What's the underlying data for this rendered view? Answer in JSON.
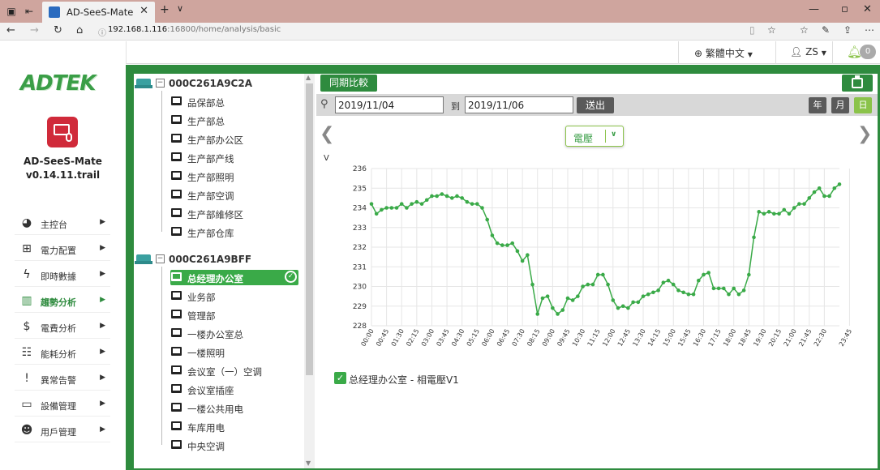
{
  "browser": {
    "tab_title": "AD-SeeS-Mate",
    "url_host": "192.168.1.116",
    "url_path": ":16800/home/analysis/basic"
  },
  "header": {
    "language": "繁體中文",
    "user": "ZS",
    "notification_count": "0"
  },
  "sidebar": {
    "logo": "ADTEK",
    "app_name": "AD-SeeS-Mate",
    "app_version": "v0.14.11.trail",
    "items": [
      {
        "label": "主控台",
        "icon": "pie-chart-icon",
        "glyph": "◕"
      },
      {
        "label": "電力配置",
        "icon": "sitemap-icon",
        "glyph": "⊞"
      },
      {
        "label": "即時數據",
        "icon": "bolt-icon",
        "glyph": "ϟ"
      },
      {
        "label": "趨勢分析",
        "icon": "bar-chart-icon",
        "glyph": "▥",
        "active": true
      },
      {
        "label": "電費分析",
        "icon": "dollar-icon",
        "glyph": "$"
      },
      {
        "label": "能耗分析",
        "icon": "clipboard-icon",
        "glyph": "☷"
      },
      {
        "label": "異常告警",
        "icon": "alert-icon",
        "glyph": "!"
      },
      {
        "label": "設備管理",
        "icon": "device-icon",
        "glyph": "▭"
      },
      {
        "label": "用戶管理",
        "icon": "user-gear-icon",
        "glyph": "☻"
      }
    ]
  },
  "tree": {
    "devices": [
      {
        "name": "000C261A9C2A",
        "children": [
          "品保部总",
          "生产部总",
          "生产部办公区",
          "生产部产线",
          "生产部照明",
          "生产部空调",
          "生产部維修区",
          "生产部仓库"
        ]
      },
      {
        "name": "000C261A9BFF",
        "children": [
          "总经理办公室",
          "业务部",
          "管理部",
          "一楼办公室总",
          "一楼照明",
          "会议室（一）空调",
          "会议室插座",
          "一楼公共用电",
          "车库用电",
          "中央空调"
        ]
      }
    ],
    "selected": "总经理办公室"
  },
  "toolbar": {
    "compare_label": "同期比較",
    "date_from": "2019/11/04",
    "to_label": "到",
    "date_to": "2019/11/06",
    "send_label": "送出",
    "periods": [
      "年",
      "月",
      "日"
    ],
    "active_period": "日",
    "parameter": "電壓"
  },
  "colors": {
    "brand_green": "#2e8b3e",
    "line_green": "#3aaa48",
    "accent_lime": "#8bc34a"
  },
  "chart_data": {
    "type": "line",
    "ylabel": "V",
    "ylim": [
      228,
      236
    ],
    "yticks": [
      228,
      229,
      230,
      231,
      232,
      233,
      234,
      235,
      236
    ],
    "grid": true,
    "xticks": [
      "00:00",
      "00:45",
      "01:30",
      "02:15",
      "03:00",
      "03:45",
      "04:30",
      "05:15",
      "06:00",
      "06:45",
      "07:30",
      "08:15",
      "09:00",
      "09:45",
      "10:30",
      "11:15",
      "12:00",
      "12:45",
      "13:30",
      "14:15",
      "15:00",
      "15:45",
      "16:30",
      "17:15",
      "18:00",
      "18:45",
      "19:30",
      "20:15",
      "21:00",
      "21:45",
      "22:30",
      "23:45"
    ],
    "series": [
      {
        "name": "总经理办公室 - 相電壓V1",
        "x_interval_minutes": 15,
        "values": [
          234.2,
          233.7,
          233.9,
          234.0,
          234.0,
          234.0,
          234.2,
          234.0,
          234.2,
          234.3,
          234.2,
          234.4,
          234.6,
          234.6,
          234.7,
          234.6,
          234.5,
          234.6,
          234.5,
          234.3,
          234.2,
          234.2,
          234.0,
          233.4,
          232.6,
          232.2,
          232.1,
          232.1,
          232.2,
          231.8,
          231.3,
          231.6,
          230.1,
          228.6,
          229.4,
          229.5,
          228.9,
          228.6,
          228.8,
          229.4,
          229.3,
          229.5,
          230.0,
          230.1,
          230.1,
          230.6,
          230.6,
          230.1,
          229.3,
          228.9,
          229.0,
          228.9,
          229.2,
          229.2,
          229.5,
          229.6,
          229.7,
          229.8,
          230.2,
          230.3,
          230.1,
          229.8,
          229.7,
          229.6,
          229.6,
          230.3,
          230.6,
          230.7,
          229.9,
          229.9,
          229.9,
          229.6,
          229.9,
          229.6,
          229.8,
          230.6,
          232.5,
          233.8,
          233.7,
          233.8,
          233.7,
          233.7,
          233.9,
          233.7,
          234.0,
          234.2,
          234.2,
          234.5,
          234.8,
          235.0,
          234.6,
          234.6,
          235.0,
          235.2
        ]
      }
    ]
  }
}
